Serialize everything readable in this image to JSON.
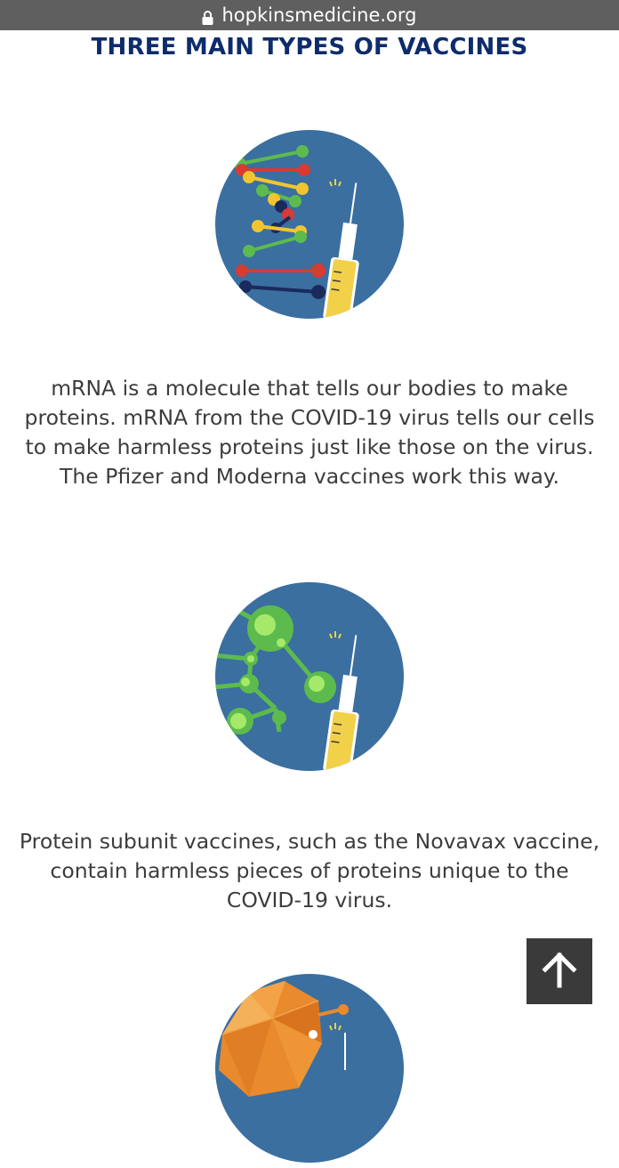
{
  "browser": {
    "url": "hopkinsmedicine.org",
    "lock_icon": "lock-icon"
  },
  "page": {
    "title": "THREE MAIN TYPES OF VACCINES",
    "sections": [
      {
        "icon": "mrna-dna-syringe-icon",
        "text": "mRNA is a molecule that tells our bodies to make proteins. mRNA from the COVID-19 virus tells our cells to make harmless proteins just like those on the virus. The Pfizer and Moderna vaccines work this way."
      },
      {
        "icon": "protein-subunit-syringe-icon",
        "text": "Protein subunit vaccines, such as the Novavax vaccine, contain harmless pieces of proteins unique to the COVID-19 virus."
      },
      {
        "icon": "viral-vector-syringe-icon",
        "text": ""
      }
    ],
    "scroll_top_icon": "arrow-up-icon"
  },
  "colors": {
    "title": "#0e2c6b",
    "circle": "#3a6fa0",
    "url_bar": "#5f5f5f",
    "body_text": "#3c3c3c"
  }
}
